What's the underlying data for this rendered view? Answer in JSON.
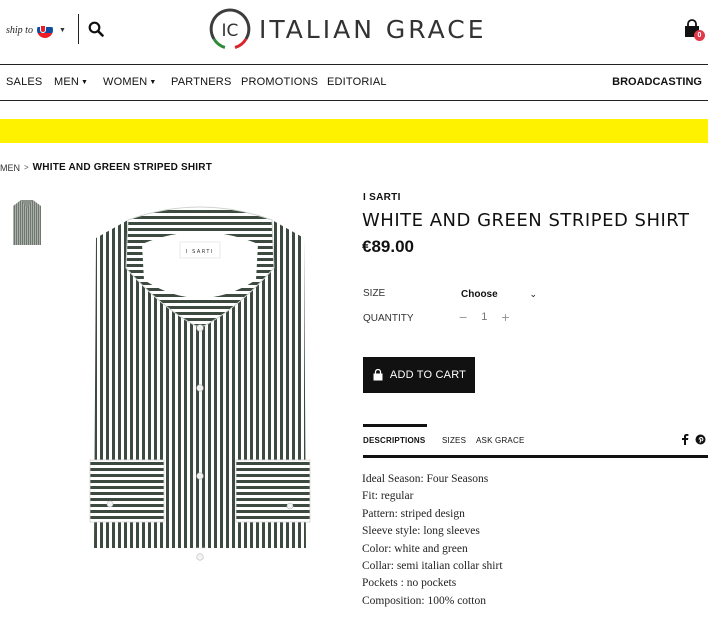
{
  "header": {
    "ship_to_label": "ship to",
    "ship_to_country_flag": "slovakia-flag",
    "logo_mark": "IC",
    "logo_text": "ITALIAN GRACE",
    "cart_count": "0"
  },
  "nav": {
    "items": [
      {
        "label": "SALES",
        "dropdown": false
      },
      {
        "label": "MEN",
        "dropdown": true
      },
      {
        "label": "WOMEN",
        "dropdown": true
      },
      {
        "label": "PARTNERS",
        "dropdown": false
      },
      {
        "label": "PROMOTIONS",
        "dropdown": false
      },
      {
        "label": "EDITORIAL",
        "dropdown": false
      }
    ],
    "right_label": "BROADCASTING"
  },
  "banner": {
    "color": "#fff200"
  },
  "breadcrumb": {
    "parent": "MEN",
    "separator": ">",
    "current": "WHITE AND GREEN STRIPED SHIRT"
  },
  "product": {
    "brand": "I SARTI",
    "title": "WHITE AND GREEN STRIPED SHIRT",
    "price": "€89.00",
    "collar_label": "I SARTI",
    "size_label": "SIZE",
    "size_value": "Choose",
    "quantity_label": "QUANTITY",
    "quantity_value": "1",
    "qty_minus": "−",
    "qty_plus": "+",
    "add_to_cart": "ADD TO CART"
  },
  "tabs": {
    "items": [
      "DESCRIPTIONS",
      "SIZES",
      "ASK GRACE"
    ],
    "active": "DESCRIPTIONS"
  },
  "description": [
    "Ideal Season: Four Seasons",
    "Fit: regular",
    "Pattern: striped design",
    "Sleeve style: long sleeves",
    "Color: white and green",
    "Collar: semi italian collar shirt",
    "Pockets : no pockets",
    "Composition: 100% cotton"
  ],
  "icons": {
    "search": "search-icon",
    "cart": "shopping-bag-icon",
    "facebook": "facebook-icon",
    "pinterest": "pinterest-icon"
  },
  "colors": {
    "stripe": "#3c4a3f",
    "badge": "#e0394a",
    "button": "#111111"
  }
}
